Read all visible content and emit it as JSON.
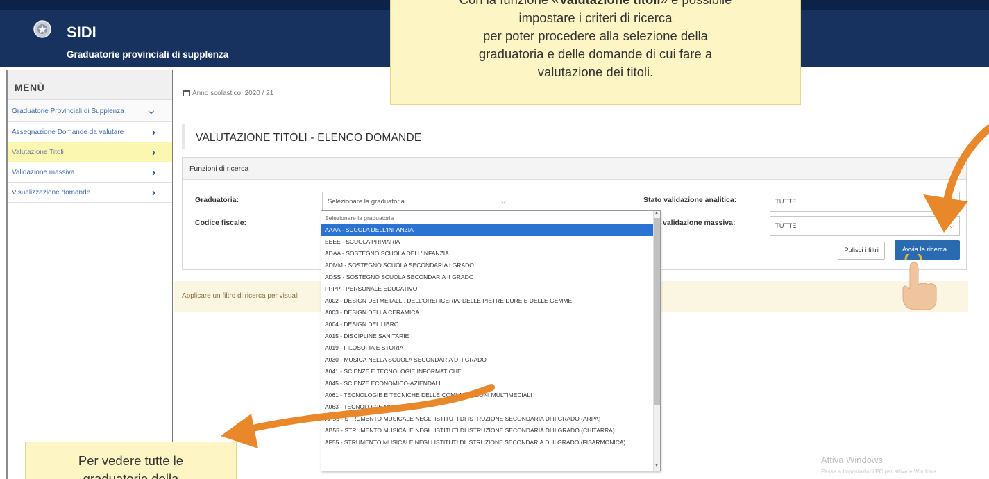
{
  "header": {
    "app_title": "SIDI",
    "app_subtitle": "Graduatorie provinciali di supplenza",
    "colors": {
      "bar": "#17325f",
      "accent": "#e8882b"
    }
  },
  "sidebar": {
    "menu_title": "MENÙ",
    "items": [
      {
        "label": "Graduatorie Provinciali di Supplenza",
        "icon": "chevron-down-icon"
      },
      {
        "label": "Assegnazione Domande da valutare",
        "icon": "chevron-right-icon"
      },
      {
        "label": "Valutazione Titoli",
        "icon": "chevron-right-icon",
        "active": true
      },
      {
        "label": "Validazione massiva",
        "icon": "chevron-right-icon"
      },
      {
        "label": "Visualizzazione domande",
        "icon": "chevron-right-icon"
      }
    ]
  },
  "main": {
    "school_year": "Anno scolastico: 2020 / 21",
    "page_title": "VALUTAZIONE TITOLI - ELENCO DOMANDE",
    "panel_title": "Funzioni di ricerca",
    "labels": {
      "graduatoria": "Graduatoria:",
      "codice_fiscale": "Codice fiscale:",
      "stato_analitica": "Stato validazione analitica:",
      "stato_massiva": "validazione massiva:"
    },
    "graduatoria_select": "Selezionare la graduatoria",
    "stato_analitica_value": "TUTTE",
    "stato_massiva_value": "TUTTE",
    "buttons": {
      "clear": "Pulisci i filtri",
      "search": "Avvia la ricerca..."
    },
    "notice": "Applicare un filtro di ricerca per visuali"
  },
  "dropdown": {
    "options": [
      "Selezionare la graduatoria",
      "AAAA - SCUOLA DELL'INFANZIA",
      "EEEE - SCUOLA PRIMARIA",
      "ADAA - SOSTEGNO SCUOLA DELL'INFANZIA",
      "ADMM - SOSTEGNO SCUOLA SECONDARIA I GRADO",
      "ADSS - SOSTEGNO SCUOLA SECONDARIA II GRADO",
      "PPPP - PERSONALE EDUCATIVO",
      "A002 - DESIGN DEI METALLI, DELL'OREFICERIA, DELLE PIETRE DURE E DELLE GEMME",
      "A003 - DESIGN DELLA CERAMICA",
      "A004 - DESIGN DEL LIBRO",
      "A015 - DISCIPLINE SANITARIE",
      "A019 - FILOSOFIA E STORIA",
      "A030 - MUSICA NELLA SCUOLA SECONDARIA DI I GRADO",
      "A041 - SCIENZE E TECNOLOGIE INFORMATICHE",
      "A045 - SCIENZE ECONOMICO-AZIENDALI",
      "A061 - TECNOLOGIE E TECNICHE DELLE COMUNICAZIONI MULTIMEDIALI",
      "A063 - TECNOLOGIE MUSICALI",
      "AA55 - STRUMENTO MUSICALE NEGLI ISTITUTI DI ISTRUZIONE SECONDARIA DI II GRADO (ARPA)",
      "AB55 - STRUMENTO MUSICALE NEGLI ISTITUTI DI ISTRUZIONE SECONDARIA DI II GRADO (CHITARRA)",
      "AF55 - STRUMENTO MUSICALE NEGLI ISTITUTI DI ISTRUZIONE SECONDARIA DI II GRADO (FISARMONICA)"
    ],
    "selected": "AAAA - SCUOLA DELL'INFANZIA"
  },
  "callouts": {
    "top_line1_pre": "Con la funzione «",
    "top_line1_bold": "Valutazione titoli",
    "top_line1_post": "» è possibile",
    "top_line2": "impostare i  criteri di ricerca",
    "top_line3": "per poter procedere alla selezione della",
    "top_line4": "graduatoria e delle domande di cui fare a",
    "top_line5": "valutazione dei titoli.",
    "bottom_line1": "Per vedere tutte le",
    "bottom_line2": "graduatorie della"
  },
  "watermark": {
    "title": "Attiva Windows",
    "subtitle": "Passa a Impostazioni PC per attivare Windows."
  }
}
